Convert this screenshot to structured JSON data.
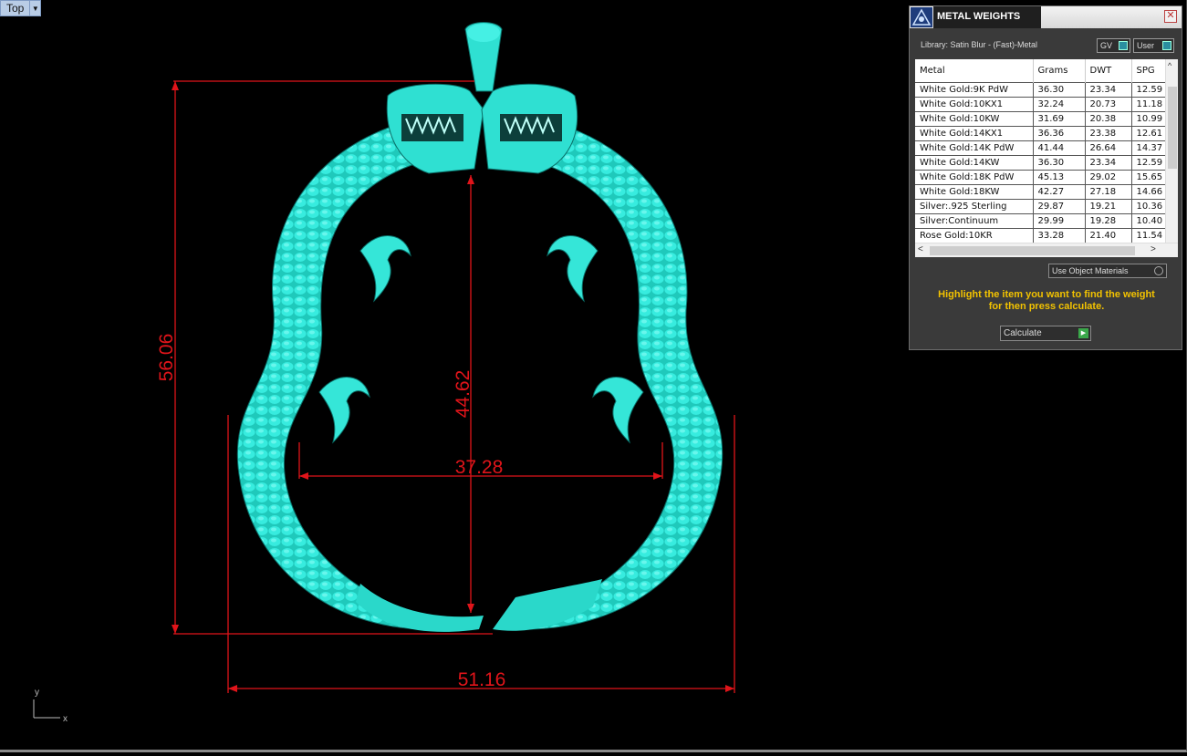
{
  "viewport": {
    "name": "Top",
    "axis_y": "y",
    "axis_x": "x",
    "model_color": "#2ee6d6",
    "dimension_color": "#e0141a"
  },
  "dimensions": {
    "height_outer": "56.06",
    "height_inner": "44.62",
    "width_inner": "37.28",
    "width_outer": "51.16"
  },
  "panel": {
    "title": "METAL WEIGHTS",
    "library": "Library: Satin Blur - (Fast)-Metal",
    "toggle_gv": "GV",
    "toggle_user": "User",
    "columns": [
      "Metal",
      "Grams",
      "DWT",
      "SPG"
    ],
    "rows": [
      [
        "White Gold:9K PdW",
        "36.30",
        "23.34",
        "12.59"
      ],
      [
        "White Gold:10KX1",
        "32.24",
        "20.73",
        "11.18"
      ],
      [
        "White Gold:10KW",
        "31.69",
        "20.38",
        "10.99"
      ],
      [
        "White Gold:14KX1",
        "36.36",
        "23.38",
        "12.61"
      ],
      [
        "White Gold:14K PdW",
        "41.44",
        "26.64",
        "14.37"
      ],
      [
        "White Gold:14KW",
        "36.30",
        "23.34",
        "12.59"
      ],
      [
        "White Gold:18K PdW",
        "45.13",
        "29.02",
        "15.65"
      ],
      [
        "White Gold:18KW",
        "42.27",
        "27.18",
        "14.66"
      ],
      [
        "Silver:.925 Sterling",
        "29.87",
        "19.21",
        "10.36"
      ],
      [
        "Silver:Continuum",
        "29.99",
        "19.28",
        "10.40"
      ],
      [
        "Rose Gold:10KR",
        "33.28",
        "21.40",
        "11.54"
      ]
    ],
    "use_object_materials": "Use Object Materials",
    "hint_line1": "Highlight the item you want to find the weight",
    "hint_line2": "for then press calculate.",
    "calculate_label": "Calculate"
  }
}
